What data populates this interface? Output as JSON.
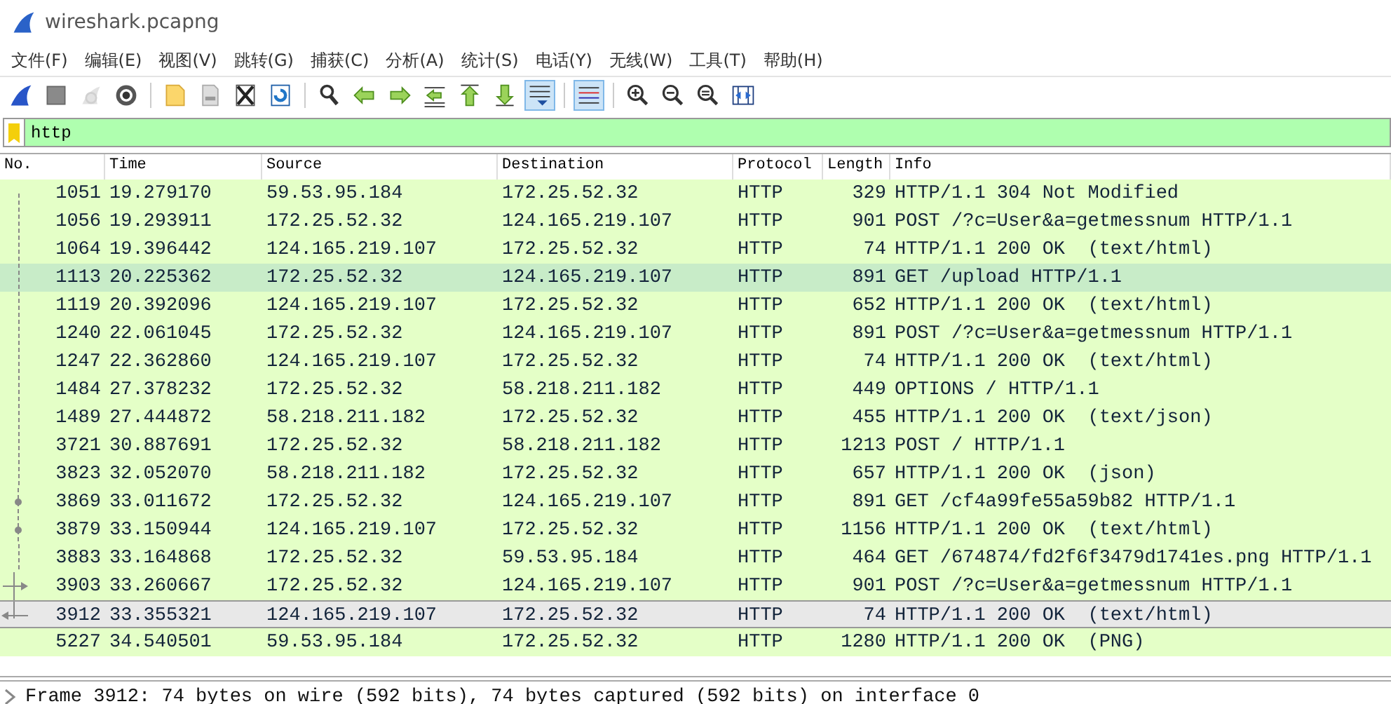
{
  "window": {
    "title": "wireshark.pcapng"
  },
  "menu": [
    "文件(F)",
    "编辑(E)",
    "视图(V)",
    "跳转(G)",
    "捕获(C)",
    "分析(A)",
    "统计(S)",
    "电话(Y)",
    "无线(W)",
    "工具(T)",
    "帮助(H)"
  ],
  "toolbar": [
    {
      "kind": "fin",
      "pressed": false,
      "disabled": false
    },
    {
      "kind": "stop",
      "pressed": false,
      "disabled": false
    },
    {
      "kind": "restart",
      "pressed": false,
      "disabled": true
    },
    {
      "kind": "gear",
      "pressed": false,
      "disabled": false
    },
    {
      "kind": "sep"
    },
    {
      "kind": "folder",
      "pressed": false,
      "disabled": false
    },
    {
      "kind": "file",
      "pressed": false,
      "disabled": false
    },
    {
      "kind": "closefile",
      "pressed": false,
      "disabled": false
    },
    {
      "kind": "reload",
      "pressed": false,
      "disabled": false
    },
    {
      "kind": "sep"
    },
    {
      "kind": "search",
      "pressed": false,
      "disabled": false
    },
    {
      "kind": "left",
      "pressed": false,
      "disabled": false
    },
    {
      "kind": "right",
      "pressed": false,
      "disabled": false
    },
    {
      "kind": "jump",
      "pressed": false,
      "disabled": false
    },
    {
      "kind": "up",
      "pressed": false,
      "disabled": false
    },
    {
      "kind": "down",
      "pressed": false,
      "disabled": false
    },
    {
      "kind": "autoscroll",
      "pressed": true,
      "disabled": false
    },
    {
      "kind": "sep"
    },
    {
      "kind": "colorize",
      "pressed": true,
      "disabled": false
    },
    {
      "kind": "sep"
    },
    {
      "kind": "zoomin",
      "pressed": false,
      "disabled": false
    },
    {
      "kind": "zoomout",
      "pressed": false,
      "disabled": false
    },
    {
      "kind": "zoomreset",
      "pressed": false,
      "disabled": false
    },
    {
      "kind": "resize",
      "pressed": false,
      "disabled": false
    }
  ],
  "filter": {
    "value": "http"
  },
  "table": {
    "columns": [
      "No.",
      "Time",
      "Source",
      "Destination",
      "Protocol",
      "Length",
      "Info"
    ],
    "rows": [
      {
        "kind": "start",
        "selected": false,
        "highlighted": false,
        "cells": [
          "1051",
          "19.279170",
          "59.53.95.184",
          "172.25.52.32",
          "HTTP",
          "329",
          "HTTP/1.1 304 Not Modified"
        ]
      },
      {
        "kind": "line",
        "selected": false,
        "highlighted": false,
        "cells": [
          "1056",
          "19.293911",
          "172.25.52.32",
          "124.165.219.107",
          "HTTP",
          "901",
          "POST /?c=User&a=getmessnum HTTP/1.1"
        ]
      },
      {
        "kind": "line",
        "selected": false,
        "highlighted": false,
        "cells": [
          "1064",
          "19.396442",
          "124.165.219.107",
          "172.25.52.32",
          "HTTP",
          "74",
          "HTTP/1.1 200 OK  (text/html)"
        ]
      },
      {
        "kind": "line",
        "selected": false,
        "highlighted": true,
        "cells": [
          "1113",
          "20.225362",
          "172.25.52.32",
          "124.165.219.107",
          "HTTP",
          "891",
          "GET /upload HTTP/1.1"
        ]
      },
      {
        "kind": "line",
        "selected": false,
        "highlighted": false,
        "cells": [
          "1119",
          "20.392096",
          "124.165.219.107",
          "172.25.52.32",
          "HTTP",
          "652",
          "HTTP/1.1 200 OK  (text/html)"
        ]
      },
      {
        "kind": "line",
        "selected": false,
        "highlighted": false,
        "cells": [
          "1240",
          "22.061045",
          "172.25.52.32",
          "124.165.219.107",
          "HTTP",
          "891",
          "POST /?c=User&a=getmessnum HTTP/1.1"
        ]
      },
      {
        "kind": "line",
        "selected": false,
        "highlighted": false,
        "cells": [
          "1247",
          "22.362860",
          "124.165.219.107",
          "172.25.52.32",
          "HTTP",
          "74",
          "HTTP/1.1 200 OK  (text/html)"
        ]
      },
      {
        "kind": "line",
        "selected": false,
        "highlighted": false,
        "cells": [
          "1484",
          "27.378232",
          "172.25.52.32",
          "58.218.211.182",
          "HTTP",
          "449",
          "OPTIONS / HTTP/1.1"
        ]
      },
      {
        "kind": "line",
        "selected": false,
        "highlighted": false,
        "cells": [
          "1489",
          "27.444872",
          "58.218.211.182",
          "172.25.52.32",
          "HTTP",
          "455",
          "HTTP/1.1 200 OK  (text/json)"
        ]
      },
      {
        "kind": "line",
        "selected": false,
        "highlighted": false,
        "cells": [
          "3721",
          "30.887691",
          "172.25.52.32",
          "58.218.211.182",
          "HTTP",
          "1213",
          "POST / HTTP/1.1"
        ]
      },
      {
        "kind": "line",
        "selected": false,
        "highlighted": false,
        "cells": [
          "3823",
          "32.052070",
          "58.218.211.182",
          "172.25.52.32",
          "HTTP",
          "657",
          "HTTP/1.1 200 OK  (json)"
        ]
      },
      {
        "kind": "dot",
        "selected": false,
        "highlighted": false,
        "cells": [
          "3869",
          "33.011672",
          "172.25.52.32",
          "124.165.219.107",
          "HTTP",
          "891",
          "GET /cf4a99fe55a59b82 HTTP/1.1"
        ]
      },
      {
        "kind": "dot",
        "selected": false,
        "highlighted": false,
        "cells": [
          "3879",
          "33.150944",
          "124.165.219.107",
          "172.25.52.32",
          "HTTP",
          "1156",
          "HTTP/1.1 200 OK  (text/html)"
        ]
      },
      {
        "kind": "line",
        "selected": false,
        "highlighted": false,
        "cells": [
          "3883",
          "33.164868",
          "172.25.52.32",
          "59.53.95.184",
          "HTTP",
          "464",
          "GET /674874/fd2f6f3479d1741es.png HTTP/1.1"
        ]
      },
      {
        "kind": "request",
        "selected": false,
        "highlighted": false,
        "cells": [
          "3903",
          "33.260667",
          "172.25.52.32",
          "124.165.219.107",
          "HTTP",
          "901",
          "POST /?c=User&a=getmessnum HTTP/1.1"
        ]
      },
      {
        "kind": "response",
        "selected": true,
        "highlighted": false,
        "cells": [
          "3912",
          "33.355321",
          "124.165.219.107",
          "172.25.52.32",
          "HTTP",
          "74",
          "HTTP/1.1 200 OK  (text/html)"
        ]
      },
      {
        "kind": "none",
        "selected": false,
        "highlighted": false,
        "cells": [
          "5227",
          "34.540501",
          "59.53.95.184",
          "172.25.52.32",
          "HTTP",
          "1280",
          "HTTP/1.1 200 OK  (PNG)"
        ]
      }
    ]
  },
  "details": {
    "expanded": false,
    "text": "Frame 3912: 74 bytes on wire (592 bits), 74 bytes captured (592 bits) on interface 0"
  }
}
